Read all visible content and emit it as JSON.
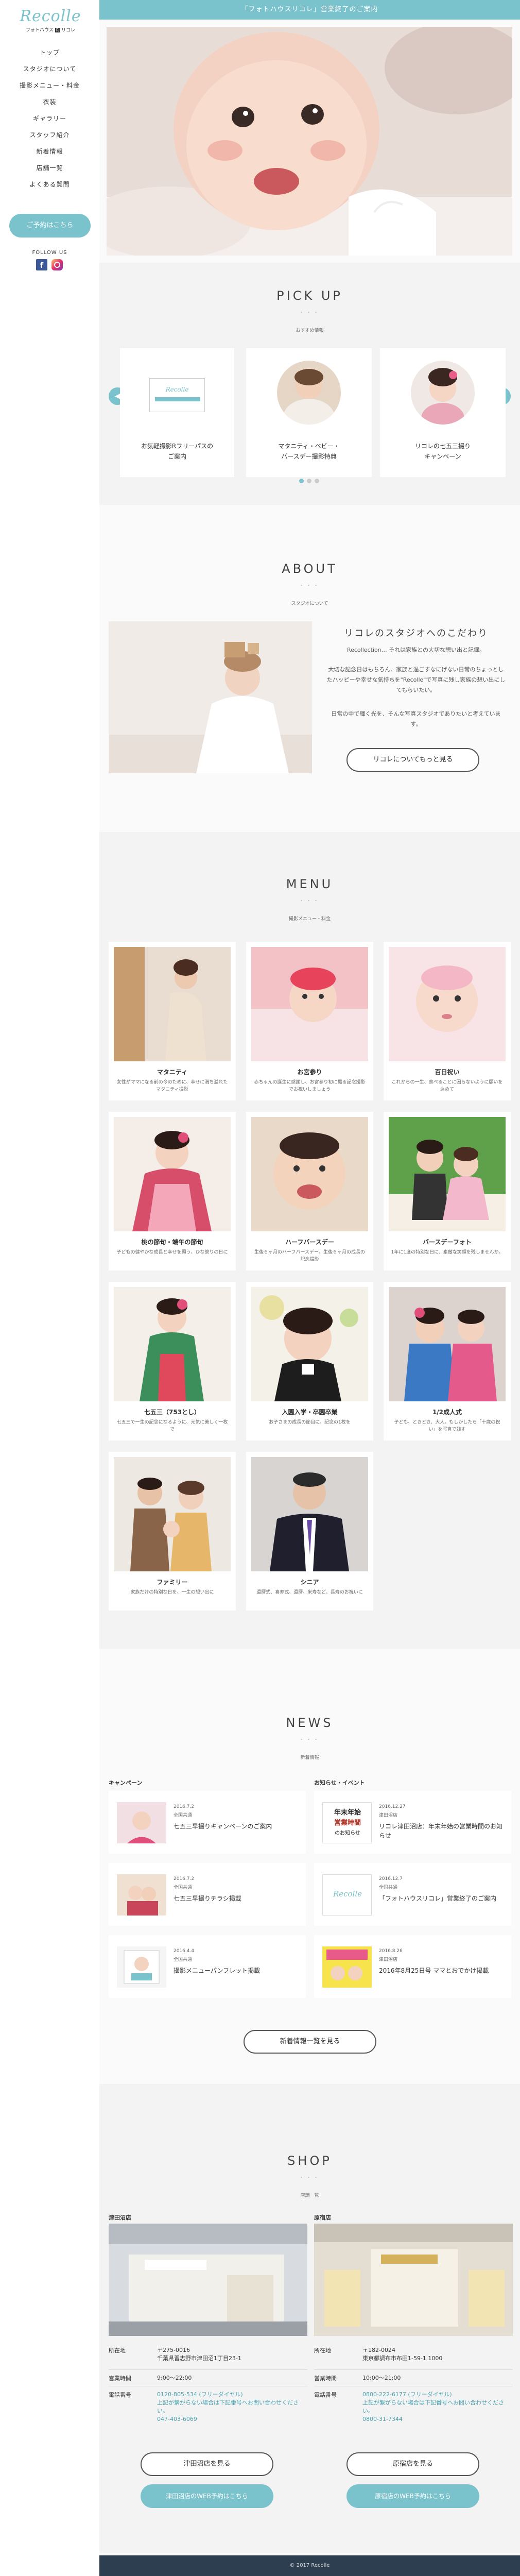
{
  "brand": {
    "logo_script": "Recolle",
    "logo_sub_a": "フォトハウス",
    "logo_sub_badge": "R",
    "logo_sub_b": "リコレ"
  },
  "nav": [
    "トップ",
    "スタジオについて",
    "撮影メニュー・料金",
    "衣装",
    "ギャラリー",
    "スタッフ紹介",
    "新着情報",
    "店舗一覧",
    "よくある質問"
  ],
  "contact_label": "ご予約はこちら",
  "follow_label": "FOLLOW US",
  "topbar_text": "「フォトハウスリコレ」営業終了のご案内",
  "pickup": {
    "title": "PICK UP",
    "dots": "・・・",
    "sub": "おすすめ情報",
    "cards": [
      "お気軽撮影Rフリーパスの\nご案内",
      "マタニティ・ベビー・\nバースデー撮影特典",
      "リコレの七五三撮り\nキャンペーン"
    ],
    "card_logo": "Recolle"
  },
  "about": {
    "title": "ABOUT",
    "dots": "・・・",
    "sub": "スタジオについて",
    "heading": "リコレのスタジオへのこだわり",
    "p1": "Recollection… それは家族との大切な想い出と記録。",
    "p2": "大切な記念日はもちろん、家族と過ごすなにげない日常のちょっとしたハッピーや幸せな気持ちを\"Recolle\"で写真に残し家族の想い出にしてもらいたい。",
    "p3": "日常の中で輝く光を、そんな写真スタジオでありたいと考えています。",
    "btn": "リコレについてもっと見る"
  },
  "menu": {
    "title": "MENU",
    "dots": "・・・",
    "sub": "撮影メニュー・料金",
    "items": [
      {
        "t": "マタニティ",
        "d": "女性がママになる前の今のために、幸せに満ち溢れたマタニティ撮影"
      },
      {
        "t": "お宮参り",
        "d": "赤ちゃんの誕生に感謝し、お宮参り初に撮る記念撮影でお祝いしましょう"
      },
      {
        "t": "百日祝い",
        "d": "これからの一生、食べることに困らないように願いを込めて"
      },
      {
        "t": "桃の節句・端午の節句",
        "d": "子どもの健やかな成長と幸せを願う、ひな祭りの日に"
      },
      {
        "t": "ハーフバースデー",
        "d": "生後６ヶ月のハーフバースデー。生後６ヶ月の成長の記念撮影"
      },
      {
        "t": "バースデーフォト",
        "d": "1年に1度の特別な日に、素敵な笑顔を残しませんか。"
      },
      {
        "t": "七五三（753とし）",
        "d": "七五三で一生の記念になるように、元気に美しく一枚で"
      },
      {
        "t": "入園入学・卒園卒業",
        "d": "お子さまの成長の節目に、記念の1枚を"
      },
      {
        "t": "1/2成人式",
        "d": "子ども、ときどき、大人。もしかしたら「十歳の祝い」を写真で残す"
      },
      {
        "t": "ファミリー",
        "d": "家族だけの特別な日を、一生の想い出に"
      },
      {
        "t": "シニア",
        "d": "還暦式、喜寿式、還暦、米寿など、長寿のお祝いに"
      }
    ]
  },
  "news": {
    "title": "NEWS",
    "dots": "・・・",
    "sub": "新着情報",
    "col1": "キャンペーン",
    "col2": "お知らせ・イベント",
    "left": [
      {
        "date": "2016.7.2",
        "cat": "全国共通",
        "t": "七五三早撮りキャンペーンのご案内"
      },
      {
        "date": "2016.7.2",
        "cat": "全国共通",
        "t": "七五三早撮りチラシ掲載"
      },
      {
        "date": "2016.4.4",
        "cat": "全国共通",
        "t": "撮影メニューパンフレット掲載"
      }
    ],
    "right": [
      {
        "date": "2016.12.27",
        "cat": "津田沼店",
        "t": "リコレ津田沼店：年末年始の営業時間のお知らせ"
      },
      {
        "date": "2016.12.7",
        "cat": "全国共通",
        "t": "「フォトハウスリコレ」営業終了のご案内"
      },
      {
        "date": "2016.8.26",
        "cat": "津田沼店",
        "t": "2016年8月25日号 ママとおでかけ掲載"
      }
    ],
    "thumb_text_year": "年末年始",
    "thumb_text_hours": "営業時間",
    "thumb_text_notice": "のお知らせ",
    "thumb_logo": "Recolle",
    "btn": "新着情報一覧を見る"
  },
  "shop": {
    "title": "SHOP",
    "dots": "・・・",
    "sub": "店舗一覧",
    "shops": [
      {
        "name": "津田沼店",
        "rows": [
          {
            "k": "所在地",
            "v": "〒275-0016\n千葉県習志野市津田沼1丁目23-1"
          },
          {
            "k": "営業時間",
            "v": "9:00〜22:00"
          },
          {
            "k": "電話番号",
            "v": "0120-805-534 (フリーダイヤル)\n上記が繋がらない場合は下記番号へお問い合わせください。",
            "v2": "047-403-6069"
          }
        ],
        "btn1": "津田沼店を見る",
        "btn2": "津田沼店のWEB予約はこちら"
      },
      {
        "name": "原宿店",
        "rows": [
          {
            "k": "所在地",
            "v": "〒182-0024\n東京都調布市布田1-59-1 1000"
          },
          {
            "k": "営業時間",
            "v": "10:00〜21:00"
          },
          {
            "k": "電話番号",
            "v": "0800-222-6177 (フリーダイヤル)\n上記が繋がらない場合は下記番号へお問い合わせください。",
            "v2": "0800-31-7344"
          }
        ],
        "btn1": "原宿店を見る",
        "btn2": "原宿店のWEB予約はこちら"
      }
    ]
  },
  "footer": "© 2017 Recolle",
  "colors": {
    "accent": "#7ac2cc",
    "footer": "#2c3e50"
  }
}
